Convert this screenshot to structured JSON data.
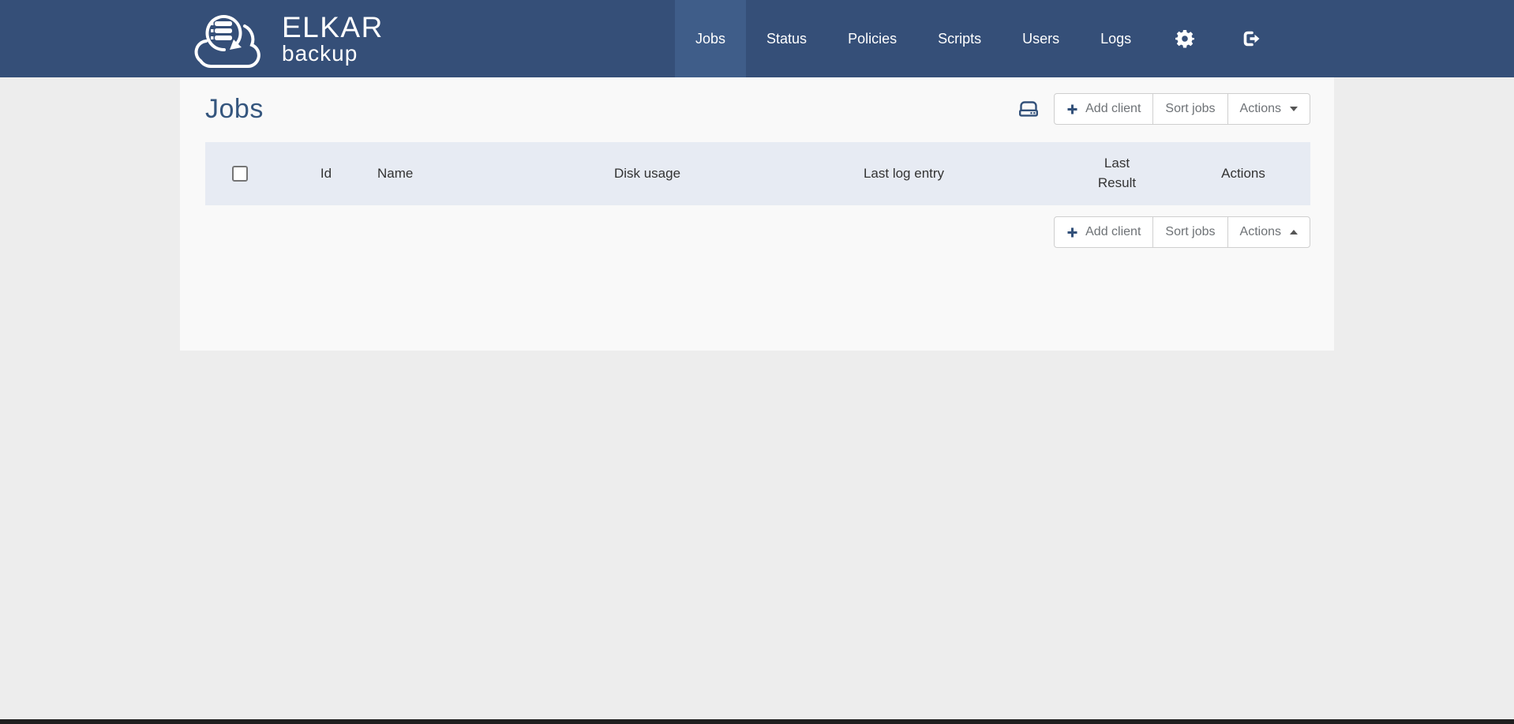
{
  "brand": {
    "title": "ELKAR",
    "subtitle": "backup",
    "logo_icon": "cloud-backup-logo-icon"
  },
  "nav": {
    "items": [
      {
        "label": "Jobs",
        "active": true
      },
      {
        "label": "Status",
        "active": false
      },
      {
        "label": "Policies",
        "active": false
      },
      {
        "label": "Scripts",
        "active": false
      },
      {
        "label": "Users",
        "active": false
      },
      {
        "label": "Logs",
        "active": false
      }
    ],
    "settings_icon": "gear-icon",
    "logout_icon": "sign-out-icon"
  },
  "page": {
    "title": "Jobs"
  },
  "toolbar": {
    "disk_icon": "hdd-icon",
    "add_client_label": "Add client",
    "plus_icon": "plus-icon",
    "sort_jobs_label": "Sort jobs",
    "actions_label": "Actions",
    "caret_down_icon": "caret-down-icon",
    "caret_up_icon": "caret-up-icon"
  },
  "table": {
    "headers": [
      "Id",
      "Name",
      "Disk usage",
      "Last log entry",
      "Last Result",
      "Actions"
    ],
    "rows": []
  },
  "colors": {
    "navbar_bg": "#354F78",
    "navbar_active_bg": "#3F5D89",
    "accent": "#33517A",
    "page_bg": "#EDEDED",
    "panel_bg": "#F9F9F9",
    "heading": "#35567E",
    "table_header_bg": "#E7EBF3",
    "table_header_text": "#333333",
    "button_text": "#6E7276",
    "button_border": "#CFCFCF",
    "bottom_bar": "#1F1F1F"
  }
}
